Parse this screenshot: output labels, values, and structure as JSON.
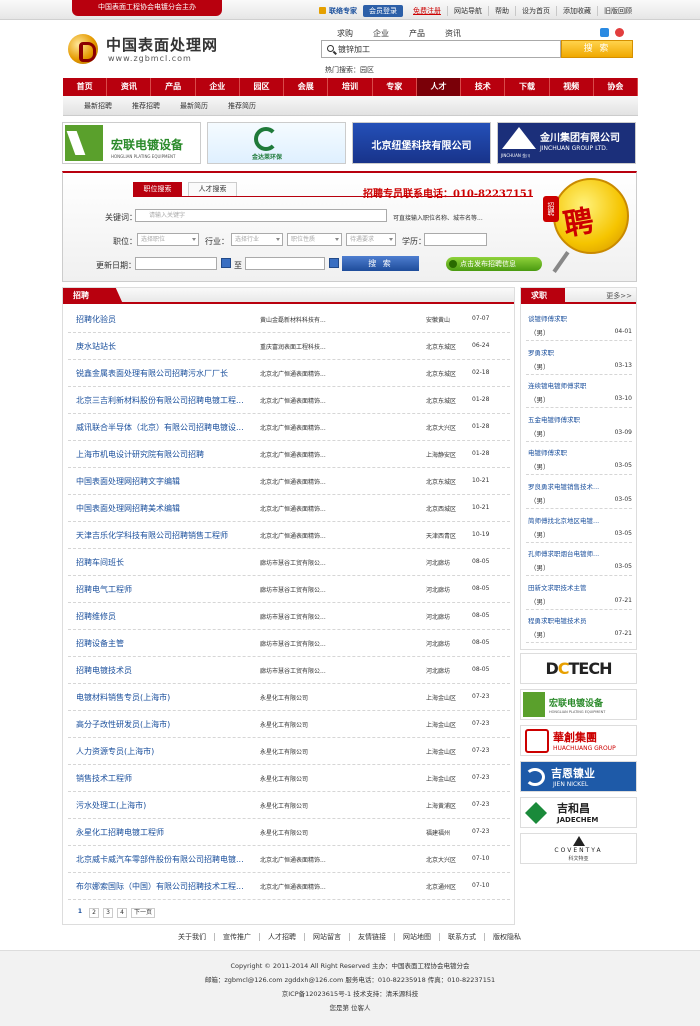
{
  "topbar": {
    "host": "中国表面工程协会电镀分会主办",
    "expert": "联络专家",
    "member_login": "会员登录",
    "register": "免费注册",
    "links": [
      "网站导航",
      "帮助",
      "设为首页",
      "添加收藏",
      "旧版回顾"
    ]
  },
  "logo": {
    "cn": "中国表面处理网",
    "en": "www.zgbmcl.com"
  },
  "search": {
    "tabs": [
      "求购",
      "企业",
      "产品",
      "资讯"
    ],
    "value": "镀锌加工",
    "button": "搜 索",
    "hot_label": "热门搜索：",
    "hot_item": "园区"
  },
  "nav": [
    "首页",
    "资讯",
    "产品",
    "企业",
    "园区",
    "会展",
    "培训",
    "专家",
    "人才",
    "技术",
    "下载",
    "视频",
    "协会"
  ],
  "nav_active_index": 8,
  "subnav": [
    "最新招聘",
    "推荐招聘",
    "最新简历",
    "推荐简历"
  ],
  "banners": {
    "b1": {
      "title": "宏联电镀设备",
      "sub": "HONGLIAN PLATING EQUIPMENT"
    },
    "b2": {
      "title": "金达莱环保"
    },
    "b3": {
      "title": "北京纽堡科技有限公司"
    },
    "b4": {
      "title": "金川集团有限公司",
      "sub": "JINCHUAN GROUP LTD.",
      "sub2": "JINCHUAN 金川"
    }
  },
  "jobsearch": {
    "tab_job": "职位搜索",
    "tab_talent": "人才搜索",
    "hotline": "招聘专员联系电话：010-82237151",
    "keyword_label": "关键词：",
    "keyword_placeholder": "请输入关键字",
    "keyword_hint": "可直接输入职位名称、城市名等...",
    "position_label": "职位：",
    "position_value": "选择职位",
    "industry_label": "行业：",
    "industry_value": "选择行业",
    "nature_value": "职位性质",
    "salary_value": "待遇要求",
    "education_label": "学历：",
    "date_label": "更新日期：",
    "date_to": "至",
    "search_button": "搜 索",
    "post_button": "点击发布招聘信息",
    "badge_tag": "招聘",
    "badge_char": "聘"
  },
  "recruit": {
    "title": "招聘",
    "rows": [
      {
        "title": "招聘化验员",
        "company": "黄山金磊新材料科技有...",
        "location": "安徽黄山",
        "date": "07-07"
      },
      {
        "title": "庚水站站长",
        "company": "重庆富润表面工程科技...",
        "location": "北京东城区",
        "date": "06-24"
      },
      {
        "title": "锐鑫金属表面处理有限公司招聘污水厂厂长",
        "company": "北京北广恒通表面精饰...",
        "location": "北京东城区",
        "date": "02-18"
      },
      {
        "title": "北京三吉利新材料股份有限公司招聘电镀工程...",
        "company": "北京北广恒通表面精饰...",
        "location": "北京东城区",
        "date": "01-28"
      },
      {
        "title": "威讯联合半导体（北京）有限公司招聘电镀设...",
        "company": "北京北广恒通表面精饰...",
        "location": "北京大兴区",
        "date": "01-28"
      },
      {
        "title": "上海市机电设计研究院有限公司招聘",
        "company": "北京北广恒通表面精饰...",
        "location": "上海静安区",
        "date": "01-28"
      },
      {
        "title": "中国表面处理网招聘文字编辑",
        "company": "北京北广恒通表面精饰...",
        "location": "北京东城区",
        "date": "10-21"
      },
      {
        "title": "中国表面处理网招聘美术编辑",
        "company": "北京北广恒通表面精饰...",
        "location": "北京西城区",
        "date": "10-21"
      },
      {
        "title": "天津吉乐化学科技有限公司招聘销售工程师",
        "company": "北京北广恒通表面精饰...",
        "location": "天津西青区",
        "date": "10-19"
      },
      {
        "title": "招聘车间班长",
        "company": "廊坊市慧谷工贸有限公...",
        "location": "河北廊坊",
        "date": "08-05"
      },
      {
        "title": "招聘电气工程师",
        "company": "廊坊市慧谷工贸有限公...",
        "location": "河北廊坊",
        "date": "08-05"
      },
      {
        "title": "招聘维修员",
        "company": "廊坊市慧谷工贸有限公...",
        "location": "河北廊坊",
        "date": "08-05"
      },
      {
        "title": "招聘设备主管",
        "company": "廊坊市慧谷工贸有限公...",
        "location": "河北廊坊",
        "date": "08-05"
      },
      {
        "title": "招聘电镀技术员",
        "company": "廊坊市慧谷工贸有限公...",
        "location": "河北廊坊",
        "date": "08-05"
      },
      {
        "title": "电镀材料销售专员(上海市)",
        "company": "永星化工有限公司",
        "location": "上海金山区",
        "date": "07-23"
      },
      {
        "title": "高分子改性研发员(上海市)",
        "company": "永星化工有限公司",
        "location": "上海金山区",
        "date": "07-23"
      },
      {
        "title": "人力资源专员(上海市)",
        "company": "永星化工有限公司",
        "location": "上海金山区",
        "date": "07-23"
      },
      {
        "title": "销售技术工程师",
        "company": "永星化工有限公司",
        "location": "上海金山区",
        "date": "07-23"
      },
      {
        "title": "污水处理工(上海市)",
        "company": "永星化工有限公司",
        "location": "上海黄浦区",
        "date": "07-23"
      },
      {
        "title": "永星化工招聘电镀工程师",
        "company": "永星化工有限公司",
        "location": "福建福州",
        "date": "07-23"
      },
      {
        "title": "北京威卡威汽车零部件股份有限公司招聘电镀...",
        "company": "北京北广恒通表面精饰...",
        "location": "北京大兴区",
        "date": "07-10"
      },
      {
        "title": "布尔娜索国际（中国）有限公司招聘技术工程...",
        "company": "北京北广恒通表面精饰...",
        "location": "北京通州区",
        "date": "07-10"
      }
    ],
    "pages": [
      "1",
      "2",
      "3",
      "4"
    ],
    "next": "下一页"
  },
  "seek": {
    "title": "求职",
    "more": "更多>>",
    "items": [
      {
        "name": "谈镀师傅求职",
        "gender": "（男）",
        "date": "04-01"
      },
      {
        "name": "罗勇求职",
        "gender": "（男）",
        "date": "03-13"
      },
      {
        "name": "连续镀电镀师傅求职",
        "gender": "（男）",
        "date": "03-10"
      },
      {
        "name": "五金电镀师傅求职",
        "gender": "（男）",
        "date": "03-09"
      },
      {
        "name": "电镀师傅求职",
        "gender": "（男）",
        "date": "03-05"
      },
      {
        "name": "罗良勇求电镀销售技术...",
        "gender": "（男）",
        "date": "03-05"
      },
      {
        "name": "简师傅找北京地区电镀...",
        "gender": "（男）",
        "date": "03-05"
      },
      {
        "name": "孔师傅求职烟台电镀师...",
        "gender": "（男）",
        "date": "03-05"
      },
      {
        "name": "田新文求职技术主管",
        "gender": "（男）",
        "date": "07-21"
      },
      {
        "name": "程勇求职电镀技术员",
        "gender": "（男）",
        "date": "07-21"
      }
    ]
  },
  "logos": {
    "dctech": {
      "a": "D",
      "b": "C",
      "c": "TECH"
    },
    "honglian": {
      "title": "宏联电镀设备",
      "sub": "HONGLIAN PLATING EQUIPMENT"
    },
    "huachuang": {
      "title": "華創集團",
      "sub": "HUACHUANG GROUP"
    },
    "jien": {
      "title": "吉恩镍业",
      "sub": "JIEN NICKEL"
    },
    "jade": {
      "title": "吉和昌",
      "sub": "JADECHEM"
    },
    "coventya": {
      "title": "COVENTYA",
      "sub": "科文特亚"
    }
  },
  "footer": {
    "links": [
      "关于我们",
      "宣传推广",
      "人才招聘",
      "网站留言",
      "友情链接",
      "网站地图",
      "联系方式",
      "版权隐私"
    ],
    "copyright": "Copyright © 2011-2014 All Right Reserved 主办：中国表面工程协会电镀分会",
    "contact": "邮箱：zgbmcl@126.com zgddxh@126.com 服务电话：010-82235918 传真：010-82237151",
    "icp": "京ICP备12023615号-1   技术支持：清禾源科技",
    "visitor": "您是第 位客人"
  },
  "colors": {
    "brand_red": "#b8000e",
    "link_blue": "#1a4f9c",
    "accent_orange": "#f0a800"
  }
}
